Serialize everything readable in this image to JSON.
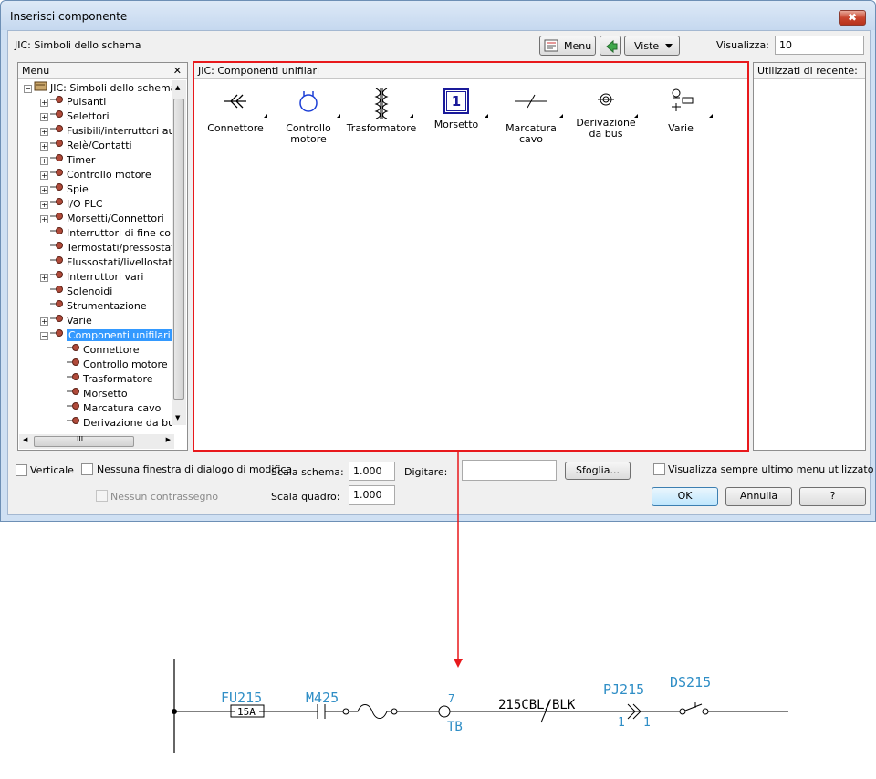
{
  "window": {
    "title": "Inserisci componente",
    "close_glyph": "✖"
  },
  "toolbar": {
    "library_label": "JIC: Simboli dello schema",
    "menu_button": "Menu",
    "views_button": "Viste",
    "display_label": "Visualizza:",
    "display_value": "10"
  },
  "menu_panel": {
    "title": "Menu",
    "close_glyph": "✕",
    "tree": [
      {
        "label": "JIC: Simboli dello schema",
        "level": 0,
        "expander": "−"
      },
      {
        "label": "Pulsanti",
        "level": 1,
        "expander": "+"
      },
      {
        "label": "Selettori",
        "level": 1,
        "expander": "+"
      },
      {
        "label": "Fusibili/interruttori autor",
        "level": 1,
        "expander": "+"
      },
      {
        "label": "Relè/Contatti",
        "level": 1,
        "expander": "+"
      },
      {
        "label": "Timer",
        "level": 1,
        "expander": "+"
      },
      {
        "label": "Controllo motore",
        "level": 1,
        "expander": "+"
      },
      {
        "label": "Spie",
        "level": 1,
        "expander": "+"
      },
      {
        "label": "I/O PLC",
        "level": 1,
        "expander": "+"
      },
      {
        "label": "Morsetti/Connettori",
        "level": 1,
        "expander": "+"
      },
      {
        "label": "Interruttori di fine corsa",
        "level": 1,
        "expander": ""
      },
      {
        "label": "Termostati/pressostati",
        "level": 1,
        "expander": ""
      },
      {
        "label": "Flussostati/livellostati",
        "level": 1,
        "expander": ""
      },
      {
        "label": "Interruttori vari",
        "level": 1,
        "expander": "+"
      },
      {
        "label": "Solenoidi",
        "level": 1,
        "expander": ""
      },
      {
        "label": "Strumentazione",
        "level": 1,
        "expander": ""
      },
      {
        "label": "Varie",
        "level": 1,
        "expander": "+"
      },
      {
        "label": "Componenti unifilari",
        "level": 1,
        "expander": "−",
        "selected": true
      },
      {
        "label": "Connettore",
        "level": 2,
        "expander": ""
      },
      {
        "label": "Controllo motore",
        "level": 2,
        "expander": ""
      },
      {
        "label": "Trasformatore",
        "level": 2,
        "expander": ""
      },
      {
        "label": "Morsetto",
        "level": 2,
        "expander": ""
      },
      {
        "label": "Marcatura cavo",
        "level": 2,
        "expander": ""
      },
      {
        "label": "Derivazione da bus",
        "level": 2,
        "expander": ""
      }
    ],
    "hscroll_grip": "III"
  },
  "content_panel": {
    "title": "JIC: Componenti unifilari",
    "items": [
      {
        "label": "Connettore",
        "icon": "connector-icon"
      },
      {
        "label": "Controllo motore",
        "icon": "motor-control-icon"
      },
      {
        "label": "Trasformatore",
        "icon": "transformer-icon"
      },
      {
        "label": "Morsetto",
        "icon": "terminal-icon",
        "glyph": "1"
      },
      {
        "label": "Marcatura cavo",
        "icon": "wire-marker-icon"
      },
      {
        "label": "Derivazione da bus",
        "icon": "bus-tap-icon"
      },
      {
        "label": "Varie",
        "icon": "misc-icon"
      }
    ],
    "highlight_color": "#e8191c"
  },
  "recent_panel": {
    "title": "Utilizzati di recente:"
  },
  "options": {
    "vertical": "Verticale",
    "no_edit_dialog": "Nessuna finestra di dialogo di modifica",
    "no_tag": "Nessun contrassegno",
    "schema_scale_label": "Scala schema:",
    "schema_scale_value": "1.000",
    "panel_scale_label": "Scala quadro:",
    "panel_scale_value": "1.000",
    "type_label": "Digitare:",
    "type_value": "",
    "browse_button": "Sfoglia...",
    "always_show_last_menu": "Visualizza sempre ultimo menu utilizzato",
    "ok_button": "OK",
    "cancel_button": "Annulla",
    "help_button": "?"
  },
  "schematic": {
    "fuse_tag": "FU215",
    "fuse_rating": "15A",
    "motor_tag": "M425",
    "terminal_number": "7",
    "terminal_strip": "TB",
    "wire_label": "215CBL/BLK",
    "connector_tag": "PJ215",
    "connector_pin_left": "1",
    "connector_pin_right": "1",
    "switch_tag": "DS215",
    "tag_color": "#2f8ec6"
  }
}
